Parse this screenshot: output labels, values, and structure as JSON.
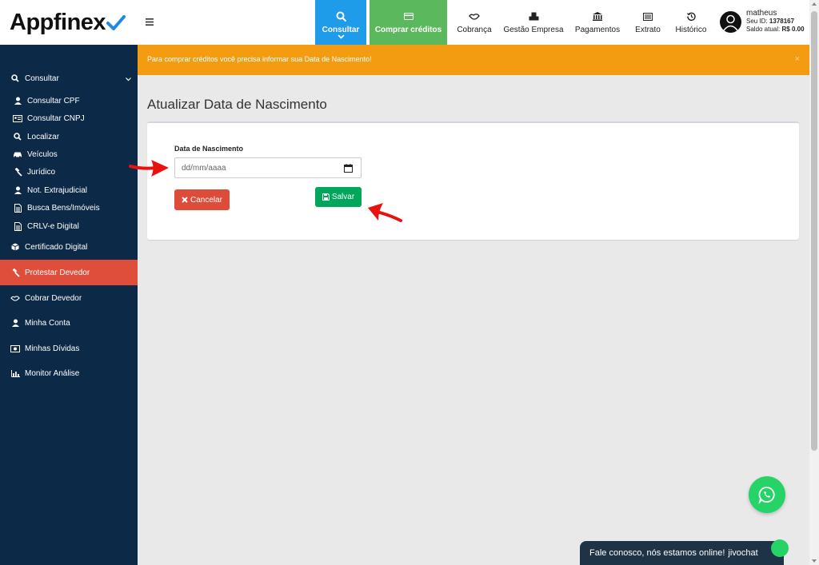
{
  "brand": {
    "name": "Appfinex"
  },
  "topnav": {
    "consultar": "Consultar",
    "comprar": "Comprar créditos",
    "cobranca": "Cobrança",
    "gestao": "Gestão Empresa",
    "pagamentos": "Pagamentos",
    "extrato": "Extrato",
    "historico": "Histórico"
  },
  "user": {
    "name": "matheus",
    "id_label": "Seu ID:",
    "id_value": "1378167",
    "balance_label": "Saldo atual:",
    "balance_value": "R$ 0.00"
  },
  "sidebar": {
    "consultar": "Consultar",
    "items": [
      "Consultar CPF",
      "Consultar CNPJ",
      "Localizar",
      "Veículos",
      "Jurídico",
      "Not. Extrajudicial",
      "Busca Bens/Imóveis",
      "CRLV-e Digital"
    ],
    "certificado": "Certificado Digital",
    "protestar": "Protestar Devedor",
    "cobrar": "Cobrar Devedor",
    "minha_conta": "Minha Conta",
    "minhas_dividas": "Minhas Dívidas",
    "monitor": "Monitor Análise"
  },
  "alert": {
    "text": "Para comprar créditos você precisa informar sua Data de Nascimento!",
    "close": "×"
  },
  "page": {
    "title": "Atualizar Data de Nascimento"
  },
  "form": {
    "date_label": "Data de Nascimento",
    "date_placeholder": "dd/mm/aaaa",
    "cancel": "Cancelar",
    "save": "Salvar"
  },
  "chat": {
    "text": "Fale conosco, nós estamos online!",
    "brand": "jivochat"
  },
  "colors": {
    "sidebar_bg": "#0c2a47",
    "active": "#de4e3a",
    "consultar": "#1e9be9",
    "comprar": "#5cb85c",
    "alert": "#f39c12",
    "cancel": "#dd4b39",
    "save": "#00a65a"
  }
}
